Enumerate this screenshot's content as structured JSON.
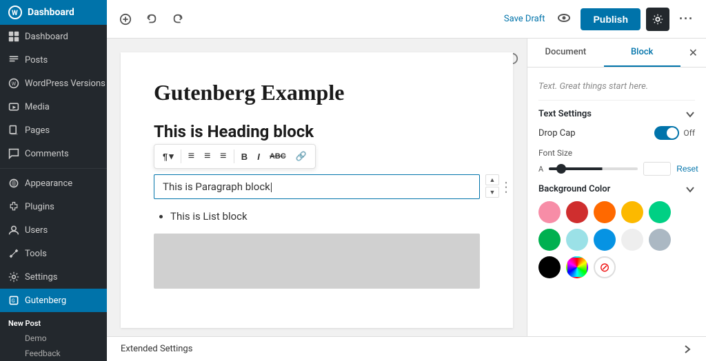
{
  "sidebar": {
    "logo_label": "Dashboard",
    "items": [
      {
        "id": "dashboard",
        "label": "Dashboard",
        "icon": "dashboard"
      },
      {
        "id": "posts",
        "label": "Posts",
        "icon": "posts"
      },
      {
        "id": "wp-versions",
        "label": "WordPress Versions",
        "icon": "wp"
      },
      {
        "id": "media",
        "label": "Media",
        "icon": "media"
      },
      {
        "id": "pages",
        "label": "Pages",
        "icon": "pages"
      },
      {
        "id": "comments",
        "label": "Comments",
        "icon": "comments"
      },
      {
        "id": "appearance",
        "label": "Appearance",
        "icon": "appearance"
      },
      {
        "id": "plugins",
        "label": "Plugins",
        "icon": "plugins"
      },
      {
        "id": "users",
        "label": "Users",
        "icon": "users"
      },
      {
        "id": "tools",
        "label": "Tools",
        "icon": "tools"
      },
      {
        "id": "settings",
        "label": "Settings",
        "icon": "settings"
      },
      {
        "id": "gutenberg",
        "label": "Gutenberg",
        "icon": "gutenberg"
      }
    ],
    "section_label": "New Post",
    "sub_items": [
      "Demo",
      "Feedback"
    ]
  },
  "toolbar": {
    "save_draft_label": "Save Draft",
    "publish_label": "Publish",
    "more_label": "···"
  },
  "editor": {
    "title": "Gutenberg Example",
    "heading": "This is Heading block",
    "paragraph": "This is Paragraph block",
    "list_item": "This is List block",
    "placeholder": "Text. Great things start here."
  },
  "formatting_toolbar": {
    "paragraph_symbol": "¶",
    "chevron": "▾",
    "align_left": "≡",
    "align_center": "≡",
    "align_right": "≡",
    "bold": "B",
    "italic": "I",
    "strikethrough": "ABC",
    "link": "🔗"
  },
  "bottom_bar": {
    "label": "Extended Settings",
    "chevron_label": "›"
  },
  "right_panel": {
    "tab_document": "Document",
    "tab_block": "Block",
    "placeholder_text": "Text. Great things start here.",
    "text_settings_label": "Text Settings",
    "drop_cap_label": "Drop Cap",
    "drop_cap_state": "Off",
    "font_size_label": "Font Size",
    "font_size_reset": "Reset",
    "background_color_label": "Background Color",
    "colors": [
      {
        "id": "pink",
        "hex": "#f78da7"
      },
      {
        "id": "red",
        "hex": "#cf2e2e"
      },
      {
        "id": "orange",
        "hex": "#ff6900"
      },
      {
        "id": "yellow",
        "hex": "#fcb900"
      },
      {
        "id": "green-light",
        "hex": "#00d084"
      },
      {
        "id": "green",
        "hex": "#00b050"
      },
      {
        "id": "blue-light",
        "hex": "#9be1e7"
      },
      {
        "id": "blue",
        "hex": "#0693e3"
      },
      {
        "id": "gray-light",
        "hex": "#eeeeee"
      },
      {
        "id": "gray",
        "hex": "#abb8c3"
      },
      {
        "id": "black",
        "hex": "#000000"
      },
      {
        "id": "gradient",
        "hex": "gradient"
      },
      {
        "id": "none",
        "hex": "none"
      }
    ]
  }
}
